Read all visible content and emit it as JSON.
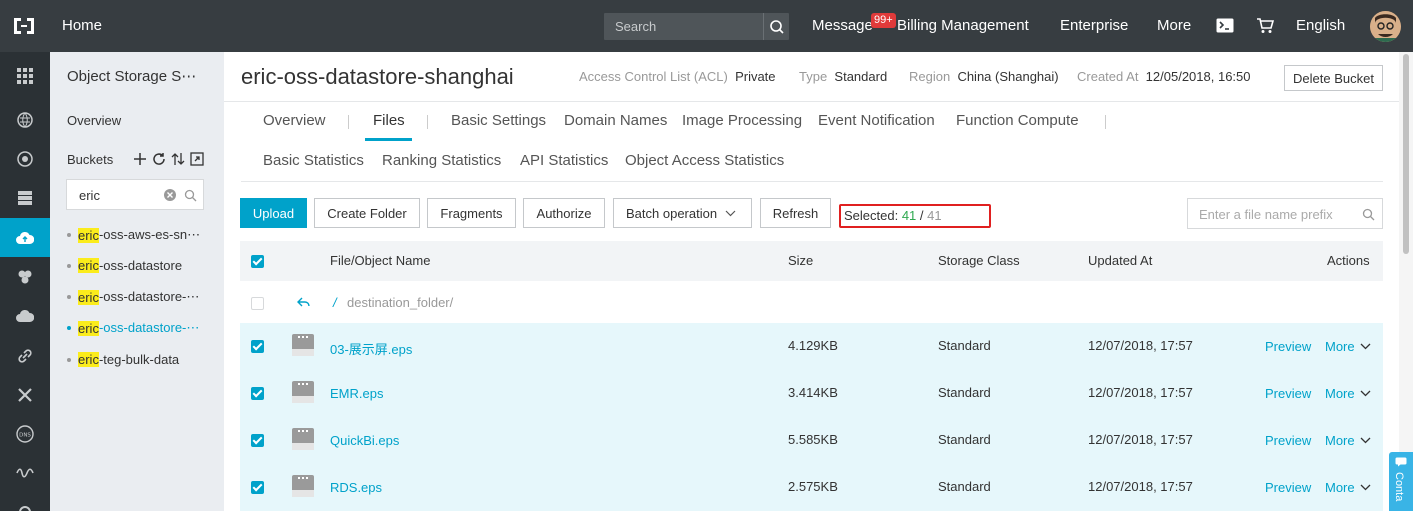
{
  "topbar": {
    "home": "Home",
    "search_placeholder": "Search",
    "message": "Message",
    "message_badge": "99+",
    "billing": "Billing Management",
    "enterprise": "Enterprise",
    "more": "More",
    "language": "English"
  },
  "sidebar": {
    "title": "Object Storage S⋯",
    "overview": "Overview",
    "buckets_label": "Buckets",
    "filter_value": "eric",
    "items": [
      {
        "prefix": "eric",
        "rest": "-oss-aws-es-sn⋯"
      },
      {
        "prefix": "eric",
        "rest": "-oss-datastore"
      },
      {
        "prefix": "eric",
        "rest": "-oss-datastore-⋯"
      },
      {
        "prefix": "eric",
        "rest": "-oss-datastore-⋯"
      },
      {
        "prefix": "eric",
        "rest": "-teg-bulk-data"
      }
    ]
  },
  "header": {
    "bucket_name": "eric-oss-datastore-shanghai",
    "acl_label": "Access Control List (ACL)",
    "acl_value": "Private",
    "type_label": "Type",
    "type_value": "Standard",
    "region_label": "Region",
    "region_value": "China (Shanghai)",
    "created_label": "Created At",
    "created_value": "12/05/2018, 16:50",
    "delete_button": "Delete Bucket"
  },
  "tabs_row1": [
    "Overview",
    "Files",
    "Basic Settings",
    "Domain Names",
    "Image Processing",
    "Event Notification",
    "Function Compute"
  ],
  "tabs_row2": [
    "Basic Statistics",
    "Ranking Statistics",
    "API Statistics",
    "Object Access Statistics"
  ],
  "toolbar": {
    "upload": "Upload",
    "create_folder": "Create Folder",
    "fragments": "Fragments",
    "authorize": "Authorize",
    "batch": "Batch operation",
    "refresh": "Refresh",
    "selected_label": "Selected:",
    "selected_count": "41",
    "selected_sep": "/",
    "selected_total": "41",
    "prefix_placeholder": "Enter a file name prefix"
  },
  "table": {
    "headers": {
      "name": "File/Object Name",
      "size": "Size",
      "storage": "Storage Class",
      "updated": "Updated At",
      "actions": "Actions"
    },
    "parent_folder": "destination_folder/",
    "rows": [
      {
        "name": "03-展示屏.eps",
        "size": "4.129KB",
        "storage": "Standard",
        "updated": "12/07/2018, 17:57",
        "preview": "Preview",
        "more": "More"
      },
      {
        "name": "EMR.eps",
        "size": "3.414KB",
        "storage": "Standard",
        "updated": "12/07/2018, 17:57",
        "preview": "Preview",
        "more": "More"
      },
      {
        "name": "QuickBi.eps",
        "size": "5.585KB",
        "storage": "Standard",
        "updated": "12/07/2018, 17:57",
        "preview": "Preview",
        "more": "More"
      },
      {
        "name": "RDS.eps",
        "size": "2.575KB",
        "storage": "Standard",
        "updated": "12/07/2018, 17:57",
        "preview": "Preview",
        "more": "More"
      }
    ]
  },
  "contact": "Conta",
  "colors": {
    "accent": "#00a2ca",
    "topbar": "#373d41",
    "rail": "#2b3135",
    "highlight": "#fbec1c",
    "alert_box": "#e02020"
  }
}
